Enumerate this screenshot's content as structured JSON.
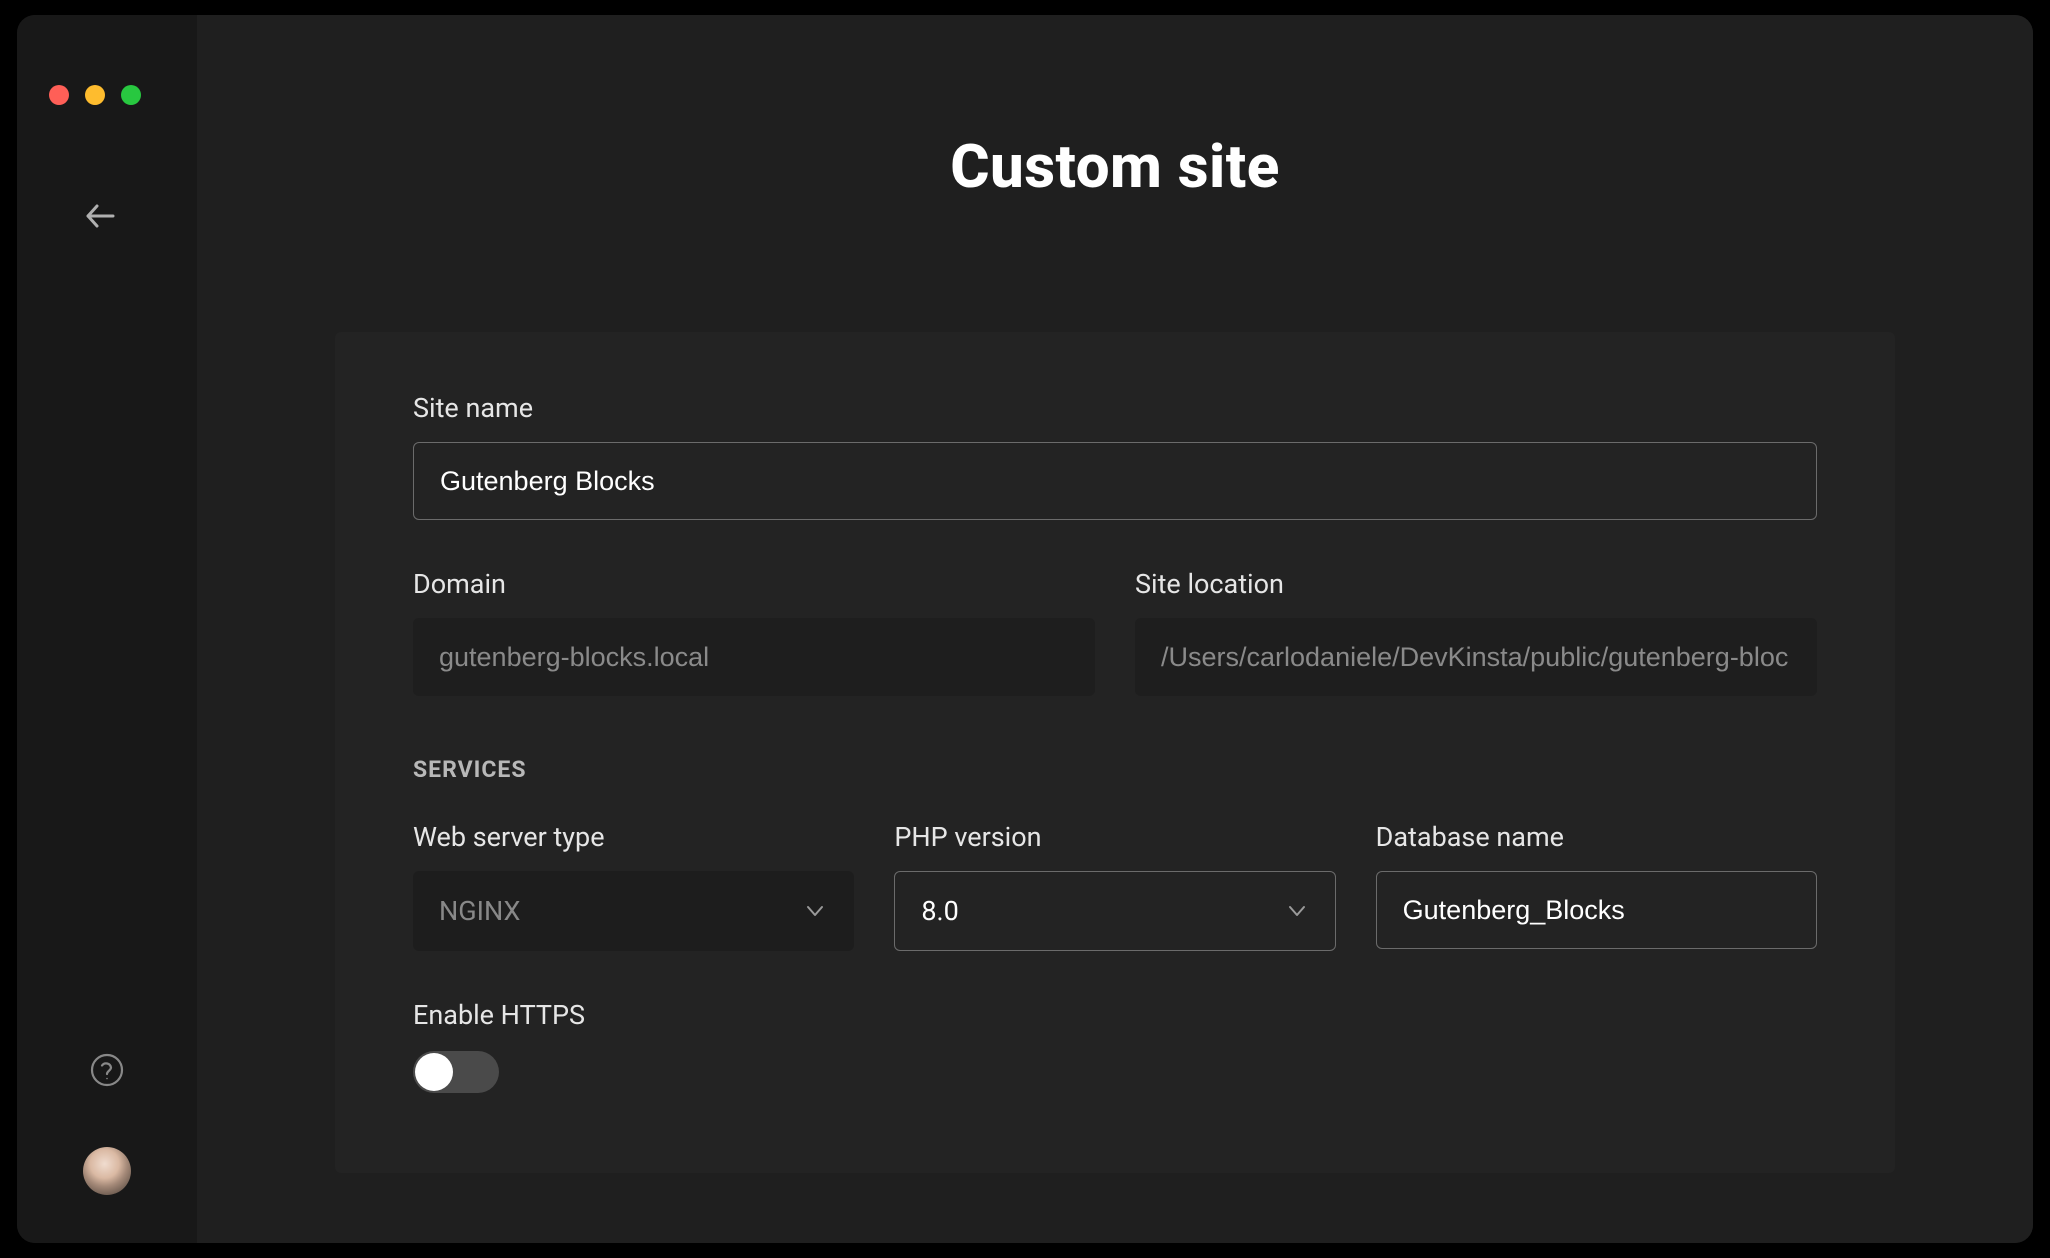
{
  "header": {
    "title": "Custom site"
  },
  "form": {
    "site_name": {
      "label": "Site name",
      "value": "Gutenberg Blocks"
    },
    "domain": {
      "label": "Domain",
      "value": "gutenberg-blocks.local"
    },
    "site_location": {
      "label": "Site location",
      "value": "/Users/carlodaniele/DevKinsta/public/gutenberg-bloc"
    },
    "services_heading": "SERVICES",
    "web_server": {
      "label": "Web server type",
      "value": "NGINX"
    },
    "php_version": {
      "label": "PHP version",
      "value": "8.0"
    },
    "database_name": {
      "label": "Database name",
      "value": "Gutenberg_Blocks"
    },
    "enable_https": {
      "label": "Enable HTTPS",
      "enabled": false
    }
  }
}
